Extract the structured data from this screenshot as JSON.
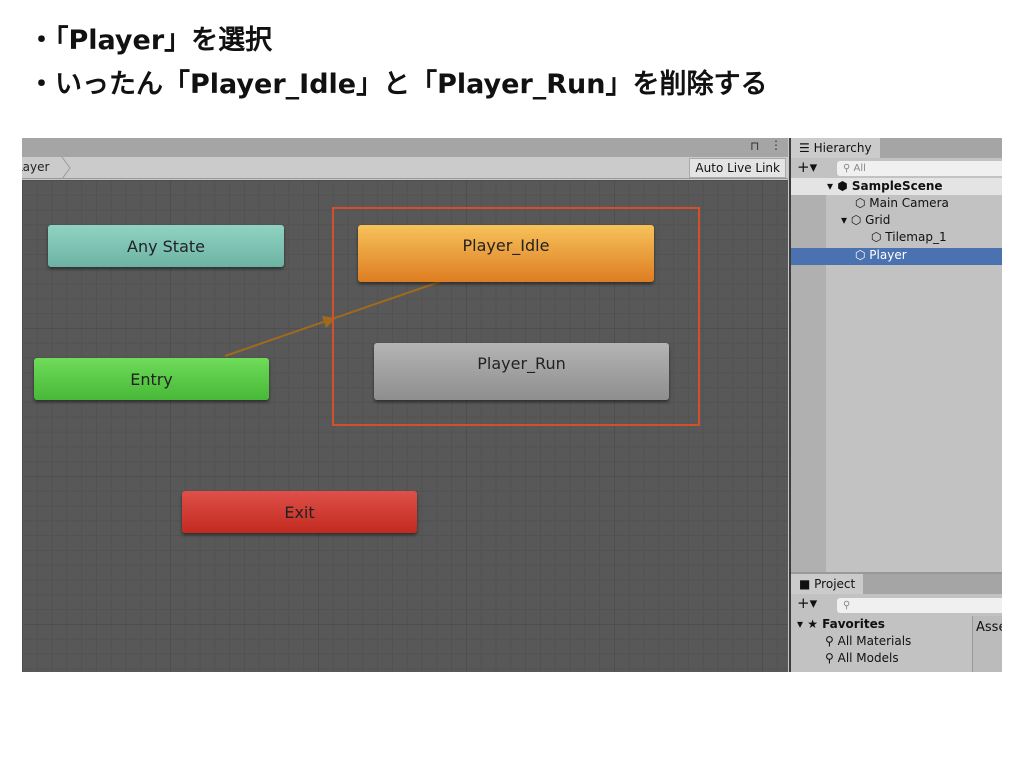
{
  "instructions": [
    "・「Player」を選択",
    "・いったん「Player_Idle」と「Player_Run」を削除する"
  ],
  "animator": {
    "breadcrumb": "Layer",
    "auto_live_link": "Auto Live Link",
    "states": {
      "any_state": "Any State",
      "player_idle": "Player_Idle",
      "player_run": "Player_Run",
      "entry": "Entry",
      "exit": "Exit"
    },
    "colors": {
      "any_state": "#7fc4b4",
      "player_idle": "#e9962e",
      "player_run": "#9e9e9e",
      "entry": "#5cc94a",
      "exit": "#cc3028",
      "selection": "#d4502c"
    }
  },
  "hierarchy": {
    "tab": "Hierarchy",
    "search_placeholder": "All",
    "items": [
      "SampleScene",
      "Main Camera",
      "Grid",
      "Tilemap_1",
      "Player"
    ],
    "selected": "Player"
  },
  "project": {
    "tab": "Project",
    "favorites": "Favorites",
    "items": [
      "All Materials",
      "All Models"
    ],
    "assets_header": "Asse"
  }
}
